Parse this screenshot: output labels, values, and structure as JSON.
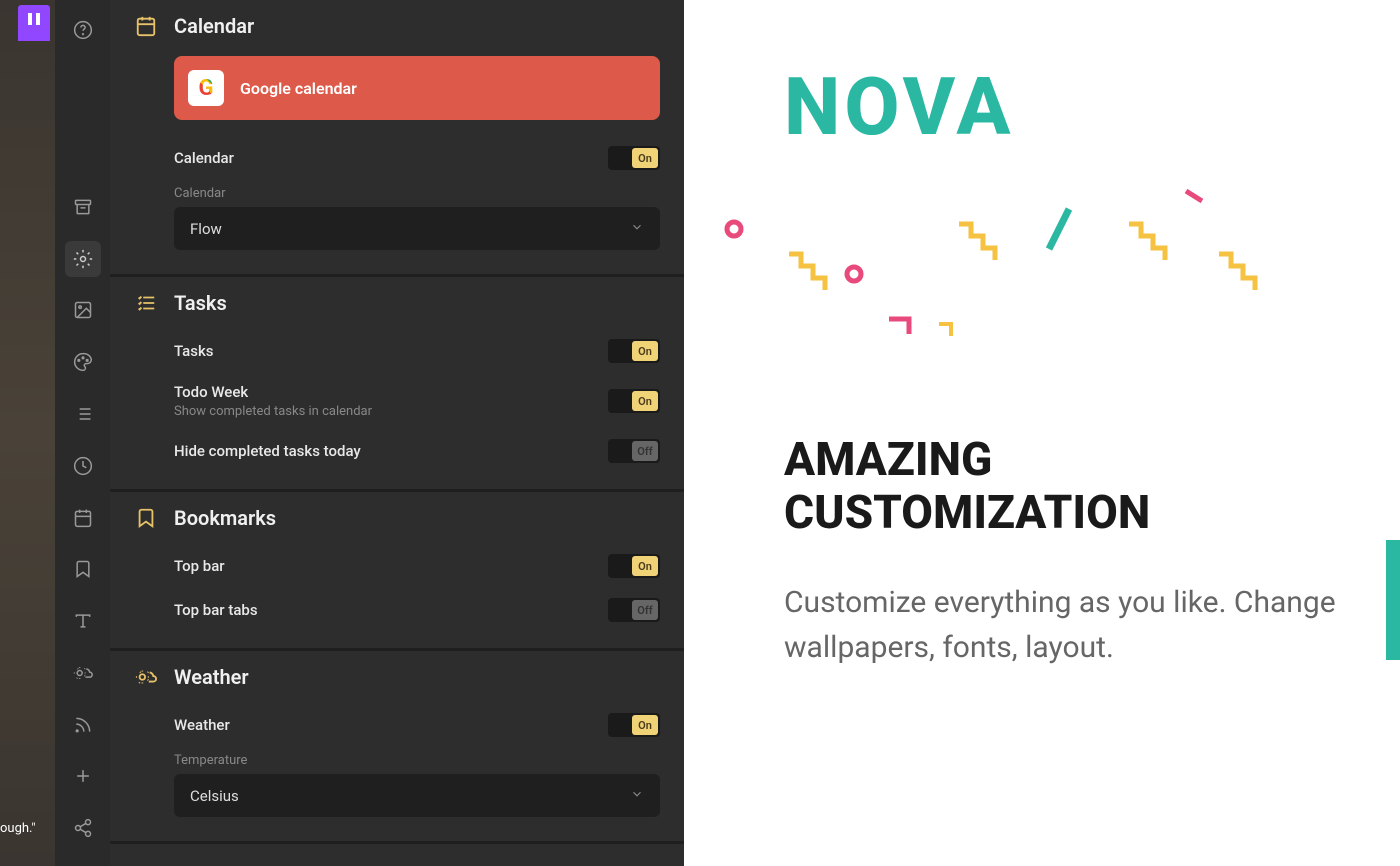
{
  "promo": {
    "brand": "NOVA",
    "heading_1": "AMAZING",
    "heading_2": "CUSTOMIZATION",
    "body": "Customize everything as you like. Change wallpapers, fonts, layout."
  },
  "bg_text": "ough.\"",
  "sections": {
    "calendar": {
      "title": "Calendar",
      "google_card": "Google calendar",
      "rows": {
        "calendar": {
          "label": "Calendar",
          "state": "On"
        }
      },
      "dropdown": {
        "label": "Calendar",
        "value": "Flow"
      }
    },
    "tasks": {
      "title": "Tasks",
      "rows": {
        "tasks": {
          "label": "Tasks",
          "state": "On"
        },
        "todo_week": {
          "label": "Todo Week",
          "sublabel": "Show completed tasks in calendar",
          "state": "On"
        },
        "hide_completed": {
          "label": "Hide completed tasks today",
          "state": "Off"
        }
      }
    },
    "bookmarks": {
      "title": "Bookmarks",
      "rows": {
        "topbar": {
          "label": "Top bar",
          "state": "On"
        },
        "topbar_tabs": {
          "label": "Top bar tabs",
          "state": "Off"
        }
      }
    },
    "weather": {
      "title": "Weather",
      "rows": {
        "weather": {
          "label": "Weather",
          "state": "On"
        }
      },
      "dropdown": {
        "label": "Temperature",
        "value": "Celsius"
      }
    }
  },
  "toggle_labels": {
    "on": "On",
    "off": "Off"
  }
}
